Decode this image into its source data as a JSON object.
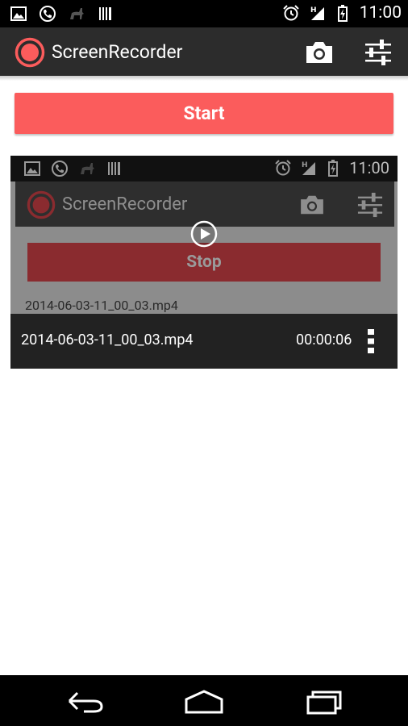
{
  "status_bar": {
    "time": "11:00",
    "network_label": "H",
    "icons": [
      "gallery-icon",
      "phone-icon",
      "animal-icon",
      "barcode-icon",
      "alarm-icon",
      "signal-icon",
      "battery-charging-icon"
    ]
  },
  "app_bar": {
    "title": "ScreenRecorder",
    "icons": [
      "record-logo-icon",
      "camera-icon",
      "settings-sliders-icon"
    ]
  },
  "start_button": {
    "label": "Start"
  },
  "recording": {
    "thumbnail": {
      "time": "11:00",
      "title": "ScreenRecorder",
      "stop_label": "Stop",
      "filename": "2014-06-03-11_00_03.mp4"
    },
    "filename": "2014-06-03-11_00_03.mp4",
    "duration": "00:00:06"
  },
  "nav_bar": {
    "icons": [
      "back-icon",
      "home-icon",
      "recents-icon"
    ]
  },
  "colors": {
    "accent": "#fb5c5c",
    "app_bar": "#2c2c2c",
    "stop_button": "#8a2b2f"
  }
}
